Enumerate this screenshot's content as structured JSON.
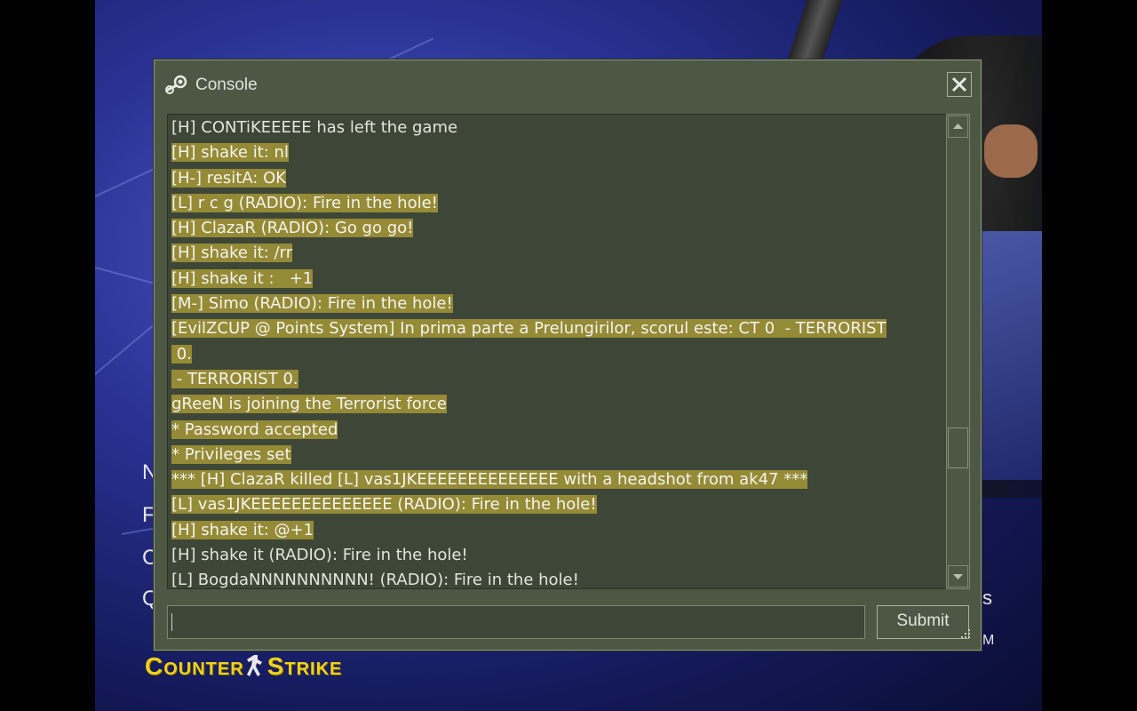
{
  "window": {
    "title": "Console",
    "icon": "steam-icon",
    "close_icon": "close-icon"
  },
  "console_lines": [
    {
      "text": "[H] CONTiKEEEEE has left the game",
      "highlighted": false
    },
    {
      "text": "[H] shake it: nl",
      "highlighted": true
    },
    {
      "text": "[H-] resitA: OK",
      "highlighted": true
    },
    {
      "text": "[L] r c g (RADIO): Fire in the hole!",
      "highlighted": true
    },
    {
      "text": "[H] ClazaR (RADIO): Go go go!",
      "highlighted": true
    },
    {
      "text": "[H] shake it: /rr",
      "highlighted": true
    },
    {
      "text": "[H] shake it :   +1",
      "highlighted": true
    },
    {
      "text": "[M-] Simo (RADIO): Fire in the hole!",
      "highlighted": true
    },
    {
      "text": "[EvilZCUP @ Points System] In prima parte a Prelungirilor, scorul este: CT 0  - TERRORIST",
      "highlighted": true
    },
    {
      "text": " 0.",
      "highlighted": true
    },
    {
      "text": " - TERRORIST 0.",
      "highlighted": true
    },
    {
      "text": "gReeN is joining the Terrorist force",
      "highlighted": true
    },
    {
      "text": "* Password accepted",
      "highlighted": true
    },
    {
      "text": "* Privileges set",
      "highlighted": true
    },
    {
      "text": "*** [H] ClazaR killed [L] vas1JKEEEEEEEEEEEEEE with a headshot from ak47 ***",
      "highlighted": true
    },
    {
      "text": "[L] vas1JKEEEEEEEEEEEEEE (RADIO): Fire in the hole!",
      "highlighted": true
    },
    {
      "text": "[H] shake it: @+1",
      "highlighted": true
    },
    {
      "text": "[H] shake it (RADIO): Fire in the hole!",
      "highlighted": false
    },
    {
      "text": "[L] BogdaNNNNNNNNNN! (RADIO): Fire in the hole!",
      "highlighted": false
    }
  ],
  "input": {
    "value": "",
    "placeholder": ""
  },
  "submit_label": "Submit",
  "scroll_position": 0.75,
  "background": {
    "logo_text_1": "C",
    "logo_text_2": "OUNTER",
    "logo_text_3": "S",
    "logo_text_4": "TRIKE",
    "menu_letters": [
      "N",
      "F",
      "C",
      "Q"
    ],
    "side_letters": [
      "s",
      "M"
    ]
  },
  "colors": {
    "panel": "#4c5844",
    "highlight": "#958a36",
    "logo": "#f2d21a"
  }
}
